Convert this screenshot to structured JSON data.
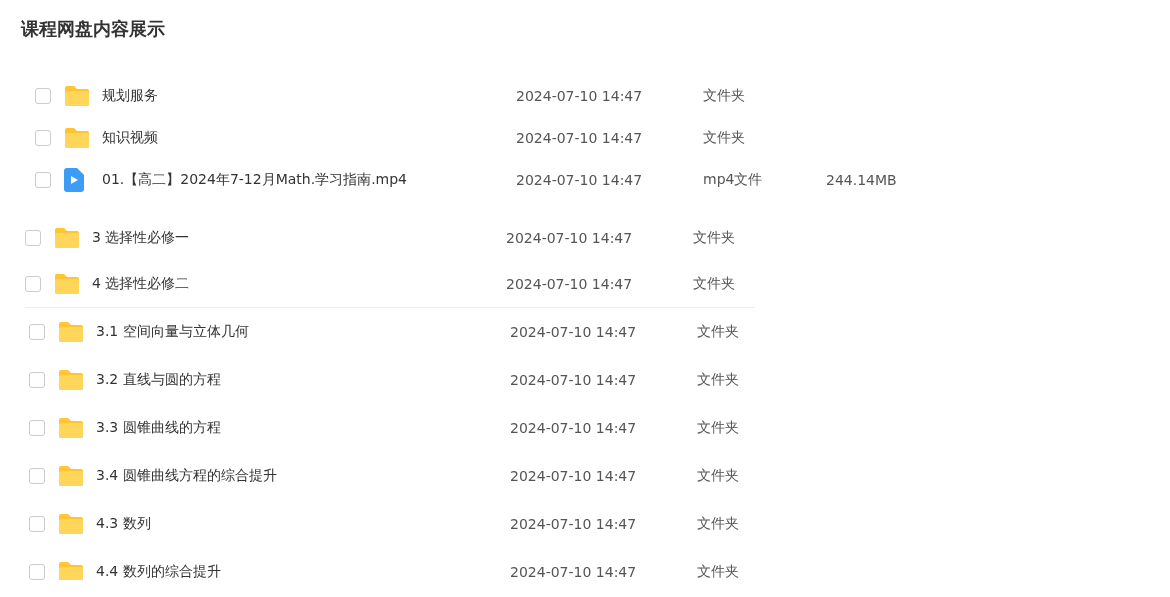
{
  "title": "课程网盘内容展示",
  "groups": [
    {
      "rows": [
        {
          "kind": "folder",
          "checked": false,
          "name": "规划服务",
          "modified": "2024-07-10 14:47",
          "type": "文件夹"
        },
        {
          "kind": "folder",
          "checked": false,
          "name": "知识视频",
          "modified": "2024-07-10 14:47",
          "type": "文件夹"
        },
        {
          "kind": "video",
          "checked": false,
          "name": "01.【高二】2024年7-12月Math.学习指南.mp4",
          "modified": "2024-07-10 14:47",
          "type": "mp4文件",
          "size": "244.14MB"
        }
      ]
    },
    {
      "rows": [
        {
          "kind": "folder",
          "checked": false,
          "name": "3 选择性必修一",
          "modified": "2024-07-10 14:47",
          "type": "文件夹"
        },
        {
          "kind": "folder",
          "checked": false,
          "name": "4 选择性必修二",
          "modified": "2024-07-10 14:47",
          "type": "文件夹"
        }
      ]
    },
    {
      "rows": [
        {
          "kind": "folder",
          "checked": false,
          "name": "3.1 空间向量与立体几何",
          "modified": "2024-07-10 14:47",
          "type": "文件夹"
        },
        {
          "kind": "folder",
          "checked": false,
          "name": "3.2 直线与圆的方程",
          "modified": "2024-07-10 14:47",
          "type": "文件夹"
        },
        {
          "kind": "folder",
          "checked": false,
          "name": "3.3 圆锥曲线的方程",
          "modified": "2024-07-10 14:47",
          "type": "文件夹"
        },
        {
          "kind": "folder",
          "checked": false,
          "name": "3.4 圆锥曲线方程的综合提升",
          "modified": "2024-07-10 14:47",
          "type": "文件夹"
        },
        {
          "kind": "folder",
          "checked": false,
          "name": "4.3 数列",
          "modified": "2024-07-10 14:47",
          "type": "文件夹"
        },
        {
          "kind": "folder",
          "checked": false,
          "name": "4.4 数列的综合提升",
          "modified": "2024-07-10 14:47",
          "type": "文件夹"
        }
      ]
    }
  ]
}
